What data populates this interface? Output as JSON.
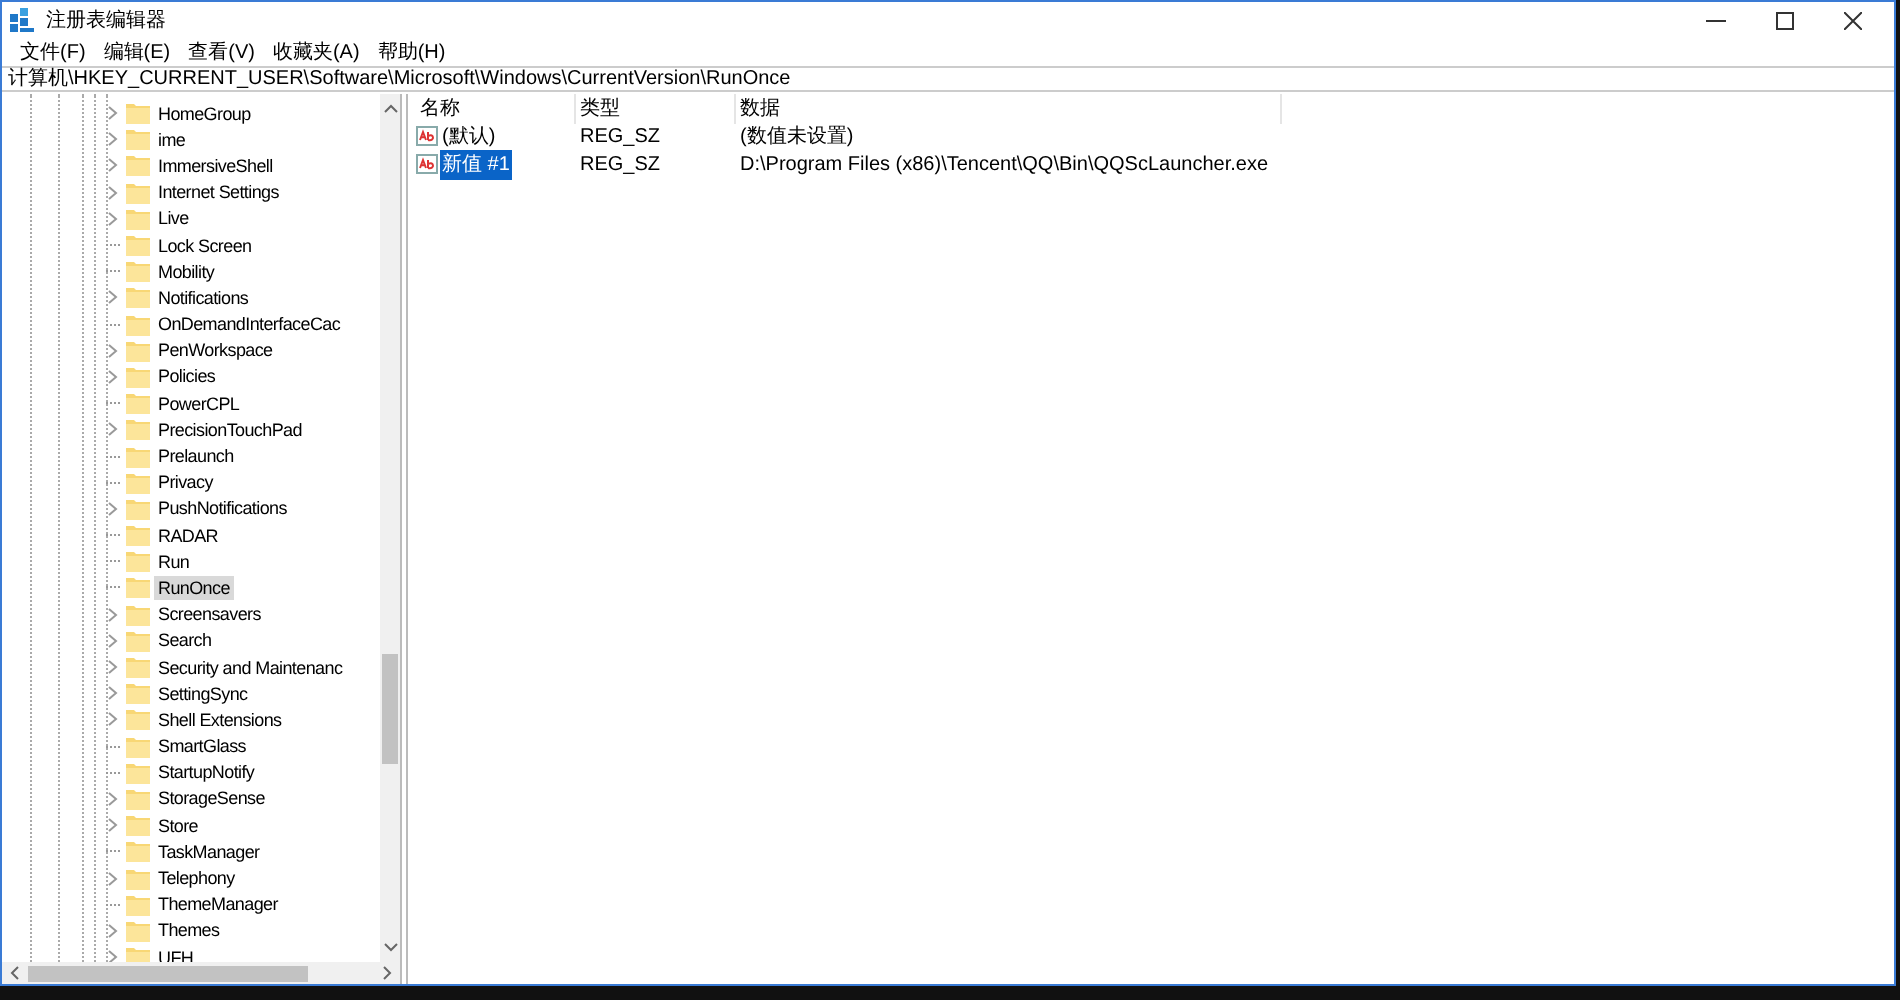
{
  "window": {
    "title": "注册表编辑器"
  },
  "menu": [
    "文件(F)",
    "编辑(E)",
    "查看(V)",
    "收藏夹(A)",
    "帮助(H)"
  ],
  "address": "计算机\\HKEY_CURRENT_USER\\Software\\Microsoft\\Windows\\CurrentVersion\\RunOnce",
  "tree": [
    {
      "label": "HomeGroup",
      "expandable": true,
      "selected": false
    },
    {
      "label": "ime",
      "expandable": true,
      "selected": false
    },
    {
      "label": "ImmersiveShell",
      "expandable": true,
      "selected": false
    },
    {
      "label": "Internet Settings",
      "expandable": true,
      "selected": false
    },
    {
      "label": "Live",
      "expandable": true,
      "selected": false
    },
    {
      "label": "Lock Screen",
      "expandable": false,
      "selected": false
    },
    {
      "label": "Mobility",
      "expandable": false,
      "selected": false
    },
    {
      "label": "Notifications",
      "expandable": true,
      "selected": false
    },
    {
      "label": "OnDemandInterfaceCac",
      "expandable": false,
      "selected": false
    },
    {
      "label": "PenWorkspace",
      "expandable": true,
      "selected": false
    },
    {
      "label": "Policies",
      "expandable": true,
      "selected": false
    },
    {
      "label": "PowerCPL",
      "expandable": false,
      "selected": false
    },
    {
      "label": "PrecisionTouchPad",
      "expandable": true,
      "selected": false
    },
    {
      "label": "Prelaunch",
      "expandable": false,
      "selected": false
    },
    {
      "label": "Privacy",
      "expandable": false,
      "selected": false
    },
    {
      "label": "PushNotifications",
      "expandable": true,
      "selected": false
    },
    {
      "label": "RADAR",
      "expandable": false,
      "selected": false
    },
    {
      "label": "Run",
      "expandable": false,
      "selected": false
    },
    {
      "label": "RunOnce",
      "expandable": false,
      "selected": true
    },
    {
      "label": "Screensavers",
      "expandable": true,
      "selected": false
    },
    {
      "label": "Search",
      "expandable": true,
      "selected": false
    },
    {
      "label": "Security and Maintenanc",
      "expandable": true,
      "selected": false
    },
    {
      "label": "SettingSync",
      "expandable": true,
      "selected": false
    },
    {
      "label": "Shell Extensions",
      "expandable": true,
      "selected": false
    },
    {
      "label": "SmartGlass",
      "expandable": false,
      "selected": false
    },
    {
      "label": "StartupNotify",
      "expandable": false,
      "selected": false
    },
    {
      "label": "StorageSense",
      "expandable": true,
      "selected": false
    },
    {
      "label": "Store",
      "expandable": true,
      "selected": false
    },
    {
      "label": "TaskManager",
      "expandable": false,
      "selected": false
    },
    {
      "label": "Telephony",
      "expandable": true,
      "selected": false
    },
    {
      "label": "ThemeManager",
      "expandable": false,
      "selected": false
    },
    {
      "label": "Themes",
      "expandable": true,
      "selected": false
    },
    {
      "label": "UFH",
      "expandable": true,
      "selected": false
    }
  ],
  "table": {
    "columns": [
      "名称",
      "类型",
      "数据"
    ],
    "rows": [
      {
        "name": "(默认)",
        "type": "REG_SZ",
        "data": "(数值未设置)",
        "selected": false
      },
      {
        "name": "新值 #1",
        "type": "REG_SZ",
        "data": "D:\\Program Files (x86)\\Tencent\\QQ\\Bin\\QQScLauncher.exe",
        "selected": true
      }
    ]
  }
}
